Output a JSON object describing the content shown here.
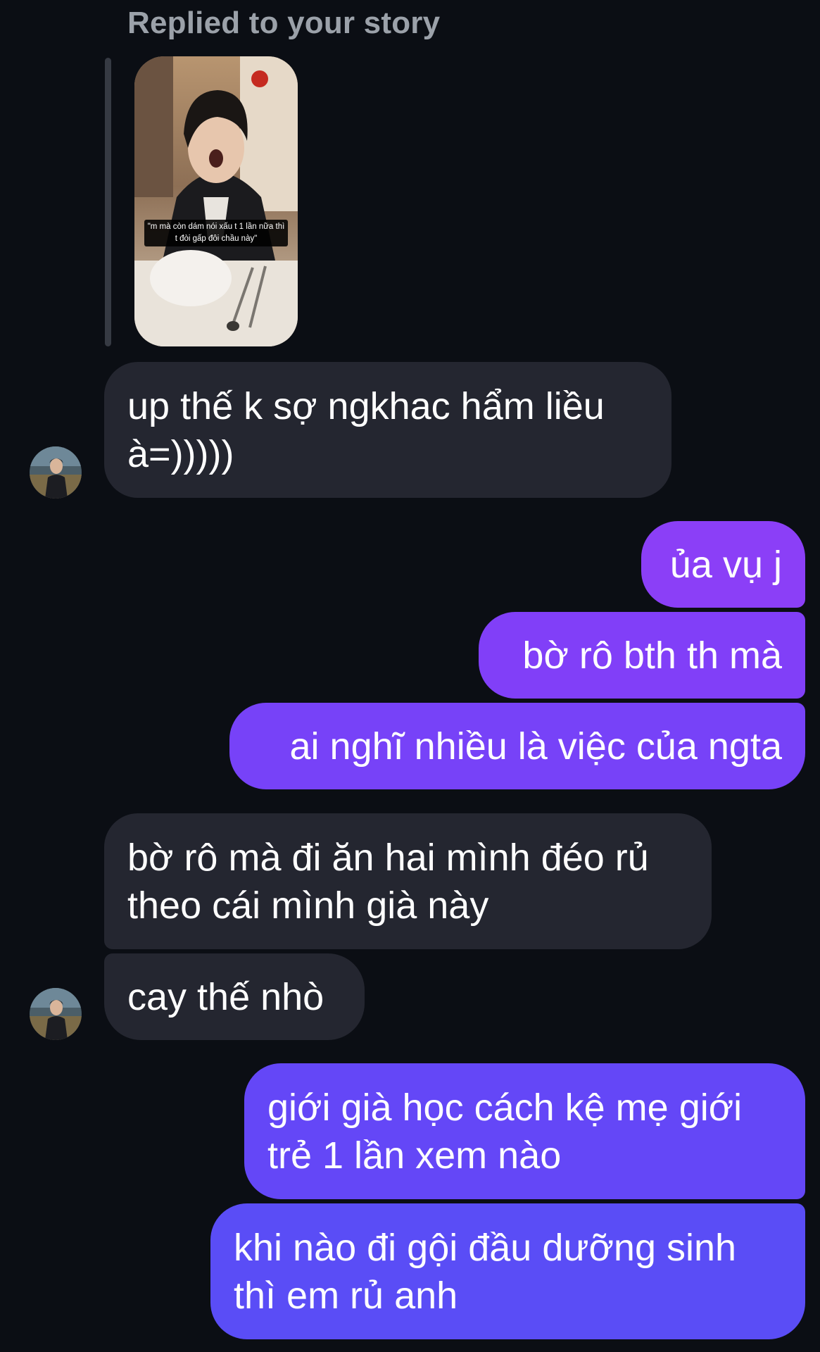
{
  "reply_header": "Replied to your story",
  "story": {
    "caption": "\"m mà còn dám nói xấu t 1 lần nữa thì t đòi gấp đôi chầu này\""
  },
  "colors": {
    "background": "#0b0e14",
    "received_bubble": "#242630",
    "sent_bubble_top": "#8a3ff7",
    "sent_bubble_bottom": "#5a4df6"
  },
  "messages": [
    {
      "direction": "received",
      "text": "up thế k sợ ngkhac hẩm liều\nà=)))))"
    },
    {
      "direction": "sent",
      "text": "ủa vụ j"
    },
    {
      "direction": "sent",
      "text": "bờ rô bth th mà"
    },
    {
      "direction": "sent",
      "text": "ai nghĩ nhiều là việc của ngta"
    },
    {
      "direction": "received",
      "text": "bờ rô mà đi ăn hai mình đéo rủ\ntheo cái mình già này"
    },
    {
      "direction": "received",
      "text": "cay thế nhò"
    },
    {
      "direction": "sent",
      "text": "giới già học cách kệ mẹ giới\ntrẻ 1 lần xem nào"
    },
    {
      "direction": "sent",
      "text": "khi nào đi gội đầu dưỡng sinh\nthì em rủ anh"
    }
  ]
}
